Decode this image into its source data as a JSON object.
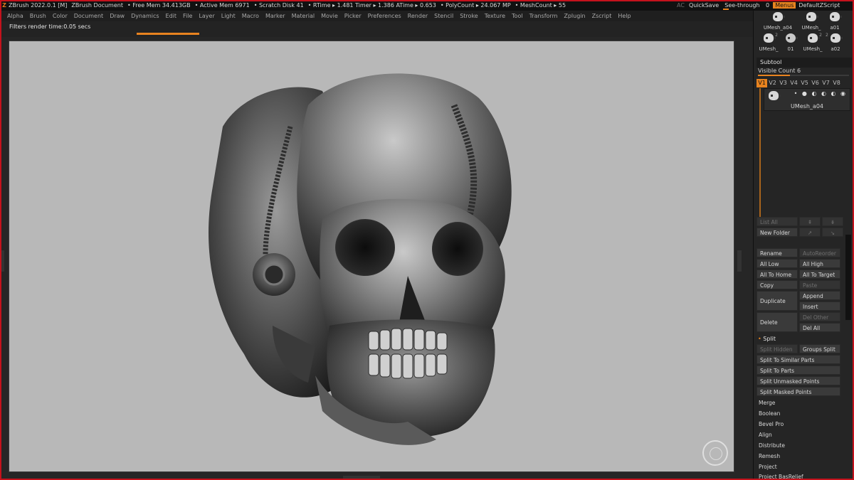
{
  "titlebar": {
    "app": "ZBrush 2022.0.1 [M]",
    "document": "ZBrush Document",
    "free_mem": "• Free Mem 34.413GB",
    "active_mem": "• Active Mem 6971",
    "scratch": "• Scratch Disk 41",
    "rtime": "• RTime ▸ 1.481 Timer ▸ 1.386 ATime ▸ 0.653",
    "polycount": "• PolyCount ▸ 24.067 MP",
    "meshcount": "• MeshCount ▸ 55",
    "ac": "AC",
    "quicksave": "QuickSave",
    "see_through_label": "See-through",
    "see_through_value": "0",
    "see_through_level": 0.12,
    "menus": "Menus",
    "script": "DefaultZScript"
  },
  "menu": [
    "Alpha",
    "Brush",
    "Color",
    "Document",
    "Draw",
    "Dynamics",
    "Edit",
    "File",
    "Layer",
    "Light",
    "Macro",
    "Marker",
    "Material",
    "Movie",
    "Picker",
    "Preferences",
    "Render",
    "Stencil",
    "Stroke",
    "Texture",
    "Tool",
    "Transform",
    "Zplugin",
    "Zscript",
    "Help"
  ],
  "status": {
    "message": "Filters render time:0.05 secs"
  },
  "thumbs": [
    {
      "label": "UMesh_a04",
      "num": ""
    },
    {
      "label": "UMesh_",
      "num": ""
    },
    {
      "label": "a01",
      "num": ""
    },
    {
      "label": "UMesh_",
      "num": "2"
    },
    {
      "label": "01",
      "num": ""
    },
    {
      "label": "UMesh_",
      "num": "2"
    },
    {
      "label": "a02",
      "num": "2"
    }
  ],
  "subtool": {
    "header": "Subtool",
    "visible_count": "Visible Count 6",
    "visible_level": 0.35,
    "tabs": [
      "V1",
      "V2",
      "V3",
      "V4",
      "V5",
      "V6",
      "V7",
      "V8"
    ],
    "item_label": "UMesh_a04",
    "list_all": "List All",
    "new_folder": "New Folder",
    "rename": "Rename",
    "autoreorder": "AutoReorder",
    "all_low": "All Low",
    "all_high": "All High",
    "all_to_home": "All To Home",
    "all_to_target": "All To Target",
    "copy": "Copy",
    "paste": "Paste",
    "duplicate": "Duplicate",
    "append": "Append",
    "insert": "Insert",
    "delete": "Delete",
    "del_other": "Del Other",
    "del_all": "Del All"
  },
  "split": {
    "header": "Split",
    "split_hidden": "Split Hidden",
    "groups_split": "Groups Split",
    "similar": "Split To Similar Parts",
    "parts": "Split To Parts",
    "unmasked": "Split Unmasked Points",
    "masked": "Split Masked Points"
  },
  "sections": [
    "Merge",
    "Boolean",
    "Bevel Pro",
    "Align",
    "Distribute",
    "Remesh",
    "Project",
    "Project BasRelief"
  ]
}
